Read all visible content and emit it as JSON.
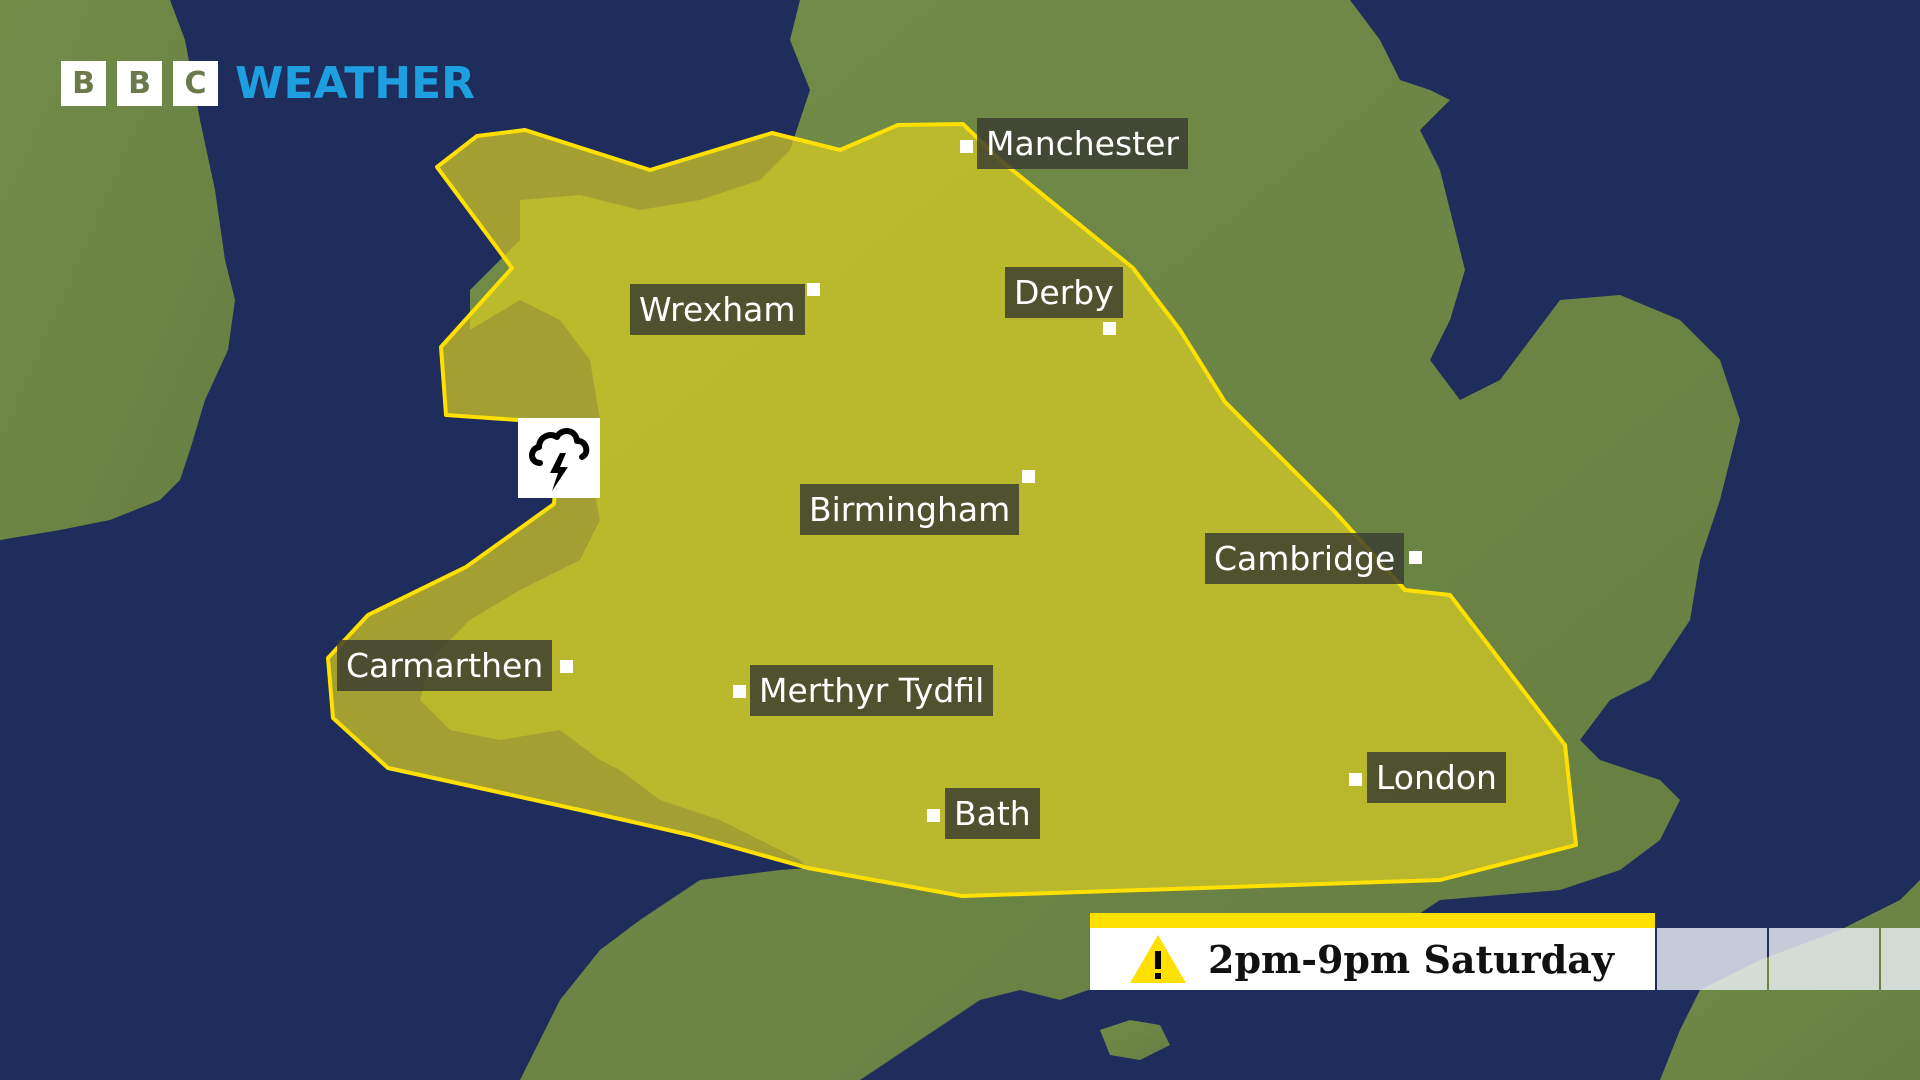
{
  "brand": {
    "letters": [
      "B",
      "B",
      "C"
    ],
    "product": "WEATHER",
    "product_color": "#1d9fe0"
  },
  "warning": {
    "level": "yellow",
    "type": "thunderstorm",
    "icon": "thunderstorm-icon",
    "fill_color": "#d8cc22",
    "outline_color": "#ffe000",
    "time_label": "2pm-9pm Saturday",
    "time_icon": "warning-triangle-icon"
  },
  "places": [
    {
      "name": "Manchester"
    },
    {
      "name": "Wrexham"
    },
    {
      "name": "Derby"
    },
    {
      "name": "Birmingham"
    },
    {
      "name": "Cambridge"
    },
    {
      "name": "Carmarthen"
    },
    {
      "name": "Merthyr Tydfil"
    },
    {
      "name": "Bath"
    },
    {
      "name": "London"
    }
  ],
  "timeline": {
    "segments_visible": 3,
    "active_segment": 0
  },
  "colors": {
    "sea": "#1e2d5c",
    "land": "#6e8a45",
    "label_bg": "#383a30"
  }
}
